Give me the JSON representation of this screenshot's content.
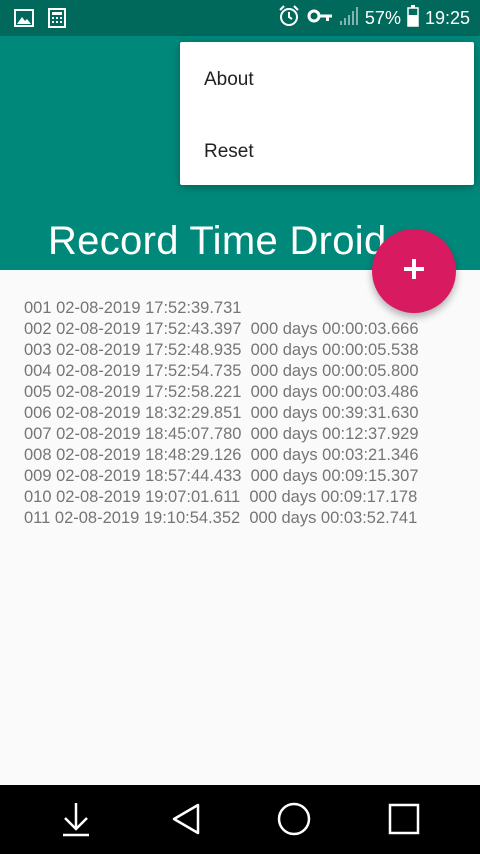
{
  "status_bar": {
    "battery_percent": "57%",
    "time": "19:25",
    "icons": [
      "image-icon",
      "calculator-icon",
      "alarm-icon",
      "key-icon",
      "signal-icon",
      "battery-icon"
    ]
  },
  "app_bar": {
    "title": "Record Time Droid",
    "color": "#00897b"
  },
  "fab": {
    "label": "+",
    "color": "#d81b60"
  },
  "overflow_menu": {
    "items": [
      {
        "label": "About"
      },
      {
        "label": "Reset"
      }
    ]
  },
  "records": [
    "001 02-08-2019 17:52:39.731",
    "002 02-08-2019 17:52:43.397  000 days 00:00:03.666",
    "003 02-08-2019 17:52:48.935  000 days 00:00:05.538",
    "004 02-08-2019 17:52:54.735  000 days 00:00:05.800",
    "005 02-08-2019 17:52:58.221  000 days 00:00:03.486",
    "006 02-08-2019 18:32:29.851  000 days 00:39:31.630",
    "007 02-08-2019 18:45:07.780  000 days 00:12:37.929",
    "008 02-08-2019 18:48:29.126  000 days 00:03:21.346",
    "009 02-08-2019 18:57:44.433  000 days 00:09:15.307",
    "010 02-08-2019 19:07:01.611  000 days 00:09:17.178",
    "011 02-08-2019 19:10:54.352  000 days 00:03:52.741"
  ],
  "nav_bar": {
    "buttons": [
      "download-icon",
      "back-icon",
      "home-icon",
      "recents-icon"
    ]
  }
}
